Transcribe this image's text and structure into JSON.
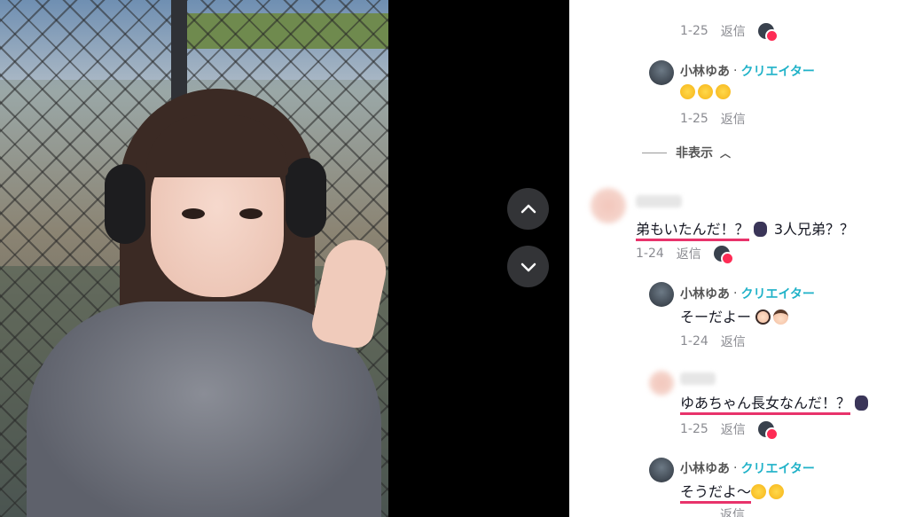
{
  "video": {
    "up_icon": "chevron-up-icon",
    "down_icon": "chevron-down-icon"
  },
  "comments": {
    "c0": {
      "date": "1-25",
      "reply": "返信"
    },
    "c1": {
      "author": "小林ゆあ",
      "sep": "·",
      "badge": "クリエイター",
      "date": "1-25",
      "reply": "返信"
    },
    "hide_label": "非表示",
    "c2": {
      "text_a": "弟もいたんだ！？",
      "text_b": "3人兄弟？？",
      "date": "1-24",
      "reply": "返信"
    },
    "c3": {
      "author": "小林ゆあ",
      "sep": "·",
      "badge": "クリエイター",
      "text": "そーだよー",
      "date": "1-24",
      "reply": "返信"
    },
    "c4": {
      "text": "ゆあちゃん長女なんだ！？",
      "date": "1-25",
      "reply": "返信"
    },
    "c5": {
      "author": "小林ゆあ",
      "sep": "·",
      "badge": "クリエイター",
      "text": "そうだよ〜",
      "date": "",
      "reply": "返信"
    }
  },
  "colors": {
    "accent": "#fe2c55",
    "creator": "#20b2c8",
    "underline": "#e8336b"
  }
}
